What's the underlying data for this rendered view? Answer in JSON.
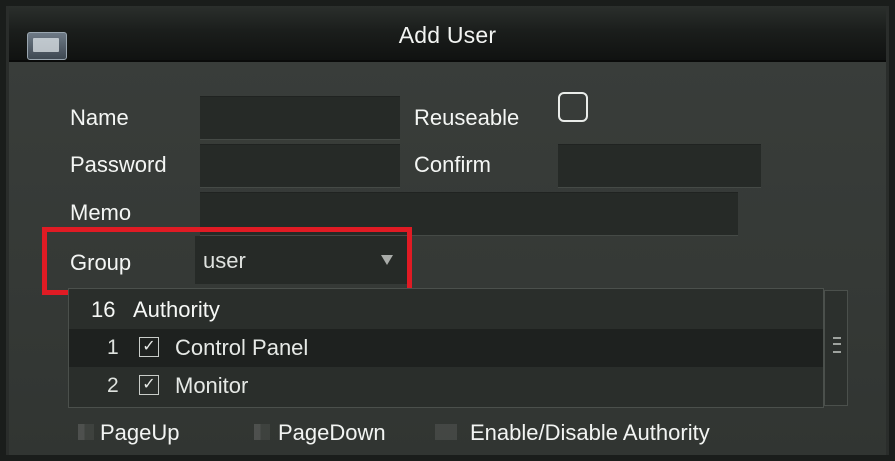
{
  "window": {
    "title": "Add User"
  },
  "form": {
    "name_label": "Name",
    "name_value": "",
    "reuseable_label": "Reuseable",
    "reuseable_checked": false,
    "password_label": "Password",
    "password_value": "",
    "confirm_label": "Confirm",
    "confirm_value": "",
    "memo_label": "Memo",
    "memo_value": "",
    "group_label": "Group",
    "group_value": "user"
  },
  "authority_list": {
    "count": "16",
    "header": "Authority",
    "rows": [
      {
        "num": "1",
        "checked": true,
        "label": "Control Panel"
      },
      {
        "num": "2",
        "checked": true,
        "label": "Monitor"
      }
    ]
  },
  "footer": {
    "page_up": "PageUp",
    "page_down": "PageDown",
    "toggle": "Enable/Disable Authority"
  },
  "colors": {
    "highlight": "#e01b24"
  },
  "icons": {
    "app": "app-icon",
    "dropdown": "chevron-down-icon",
    "check": "check-icon"
  }
}
